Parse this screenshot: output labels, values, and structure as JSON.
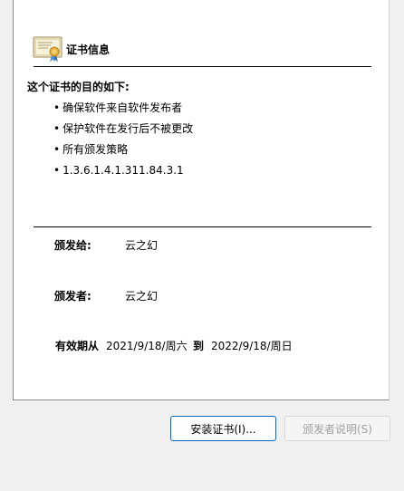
{
  "header": {
    "title": "证书信息"
  },
  "purposes": {
    "heading": "这个证书的目的如下:",
    "items": [
      "确保软件来自软件发布者",
      "保护软件在发行后不被更改",
      "所有颁发策略",
      "1.3.6.1.4.1.311.84.3.1"
    ]
  },
  "issued_to": {
    "label": "颁发给:",
    "value": "云之幻"
  },
  "issued_by": {
    "label": "颁发者:",
    "value": "云之幻"
  },
  "validity": {
    "from_label": "有效期从",
    "from_date": "2021/9/18/周六",
    "to_label": "到",
    "to_date": "2022/9/18/周日"
  },
  "buttons": {
    "install": "安装证书(I)...",
    "issuer_statement": "颁发者说明(S)"
  },
  "icons": {
    "certificate": "certificate-icon"
  }
}
